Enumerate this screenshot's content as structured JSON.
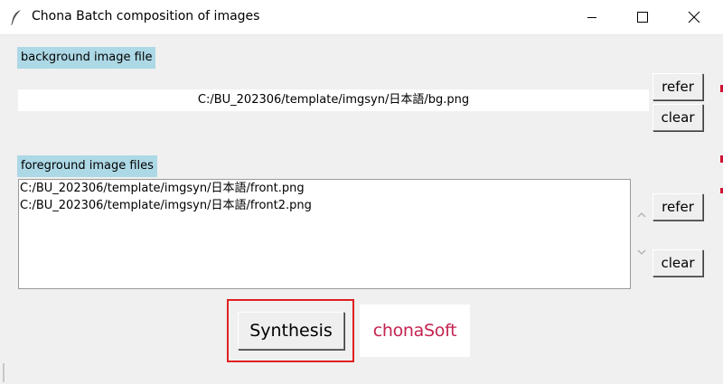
{
  "window": {
    "title": "Chona Batch composition of images",
    "controls": {
      "minimize_icon": "minimize-icon",
      "maximize_icon": "maximize-icon",
      "close_icon": "close-icon"
    }
  },
  "background": {
    "label": "background image file",
    "path": "C:/BU_202306/template/imgsyn/日本語/bg.png",
    "refer_label": "refer",
    "clear_label": "clear"
  },
  "foreground": {
    "label": "foreground image files",
    "files": [
      "C:/BU_202306/template/imgsyn/日本語/front.png",
      "C:/BU_202306/template/imgsyn/日本語/front2.png"
    ],
    "refer_label": "refer",
    "clear_label": "clear"
  },
  "actions": {
    "synthesis_label": "Synthesis"
  },
  "logo": {
    "text": "chonaSoft",
    "color": "#c4234f"
  },
  "colors": {
    "label_bg": "#add8e6",
    "highlight": "#e02020"
  }
}
